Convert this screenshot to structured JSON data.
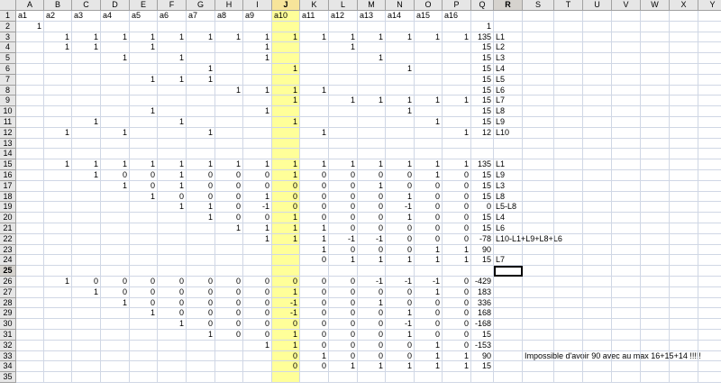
{
  "sheet": {
    "columns": [
      "A",
      "B",
      "C",
      "D",
      "E",
      "F",
      "G",
      "H",
      "I",
      "J",
      "K",
      "L",
      "M",
      "N",
      "O",
      "P",
      "Q",
      "R",
      "S",
      "T",
      "U",
      "V",
      "W",
      "X",
      "Y"
    ],
    "row_count": 35,
    "highlight_column": "J",
    "selected_column_header": "R",
    "selected_row_header": 25,
    "active_cell": "R25",
    "cells": {
      "1": {
        "A": "a1",
        "B": "a2",
        "C": "a3",
        "D": "a4",
        "E": "a5",
        "F": "a6",
        "G": "a7",
        "H": "a8",
        "I": "a9",
        "J": "a10",
        "K": "a11",
        "L": "a12",
        "M": "a13",
        "N": "a14",
        "O": "a15",
        "P": "a16"
      },
      "2": {
        "A": "1",
        "Q": "1"
      },
      "3": {
        "B": "1",
        "C": "1",
        "D": "1",
        "E": "1",
        "F": "1",
        "G": "1",
        "H": "1",
        "I": "1",
        "J": "1",
        "K": "1",
        "L": "1",
        "M": "1",
        "N": "1",
        "O": "1",
        "P": "1",
        "Q": "135",
        "R": "L1"
      },
      "4": {
        "B": "1",
        "C": "1",
        "E": "1",
        "I": "1",
        "L": "1",
        "Q": "15",
        "R": "L2"
      },
      "5": {
        "D": "1",
        "F": "1",
        "I": "1",
        "M": "1",
        "Q": "15",
        "R": "L3"
      },
      "6": {
        "G": "1",
        "J": "1",
        "N": "1",
        "Q": "15",
        "R": "L4"
      },
      "7": {
        "E": "1",
        "F": "1",
        "G": "1",
        "Q": "15",
        "R": "L5"
      },
      "8": {
        "H": "1",
        "I": "1",
        "J": "1",
        "K": "1",
        "Q": "15",
        "R": "L6"
      },
      "9": {
        "J": "1",
        "L": "1",
        "M": "1",
        "N": "1",
        "O": "1",
        "P": "1",
        "Q": "15",
        "R": "L7"
      },
      "10": {
        "E": "1",
        "I": "1",
        "N": "1",
        "Q": "15",
        "R": "L8"
      },
      "11": {
        "C": "1",
        "F": "1",
        "J": "1",
        "O": "1",
        "Q": "15",
        "R": "L9"
      },
      "12": {
        "B": "1",
        "D": "1",
        "G": "1",
        "K": "1",
        "P": "1",
        "Q": "12",
        "R": "L10"
      },
      "15": {
        "B": "1",
        "C": "1",
        "D": "1",
        "E": "1",
        "F": "1",
        "G": "1",
        "H": "1",
        "I": "1",
        "J": "1",
        "K": "1",
        "L": "1",
        "M": "1",
        "N": "1",
        "O": "1",
        "P": "1",
        "Q": "135",
        "R": "L1"
      },
      "16": {
        "C": "1",
        "D": "0",
        "E": "0",
        "F": "1",
        "G": "0",
        "H": "0",
        "I": "0",
        "J": "1",
        "K": "0",
        "L": "0",
        "M": "0",
        "N": "0",
        "O": "1",
        "P": "0",
        "Q": "15",
        "R": "L9"
      },
      "17": {
        "D": "1",
        "E": "0",
        "F": "1",
        "G": "0",
        "H": "0",
        "I": "0",
        "J": "0",
        "K": "0",
        "L": "0",
        "M": "1",
        "N": "0",
        "O": "0",
        "P": "0",
        "Q": "15",
        "R": "L3"
      },
      "18": {
        "E": "1",
        "F": "0",
        "G": "0",
        "H": "0",
        "I": "1",
        "J": "0",
        "K": "0",
        "L": "0",
        "M": "0",
        "N": "1",
        "O": "0",
        "P": "0",
        "Q": "15",
        "R": "L8"
      },
      "19": {
        "F": "1",
        "G": "1",
        "H": "0",
        "I": "-1",
        "J": "0",
        "K": "0",
        "L": "0",
        "M": "0",
        "N": "-1",
        "O": "0",
        "P": "0",
        "Q": "0",
        "R": "L5-L8"
      },
      "20": {
        "G": "1",
        "H": "0",
        "I": "0",
        "J": "1",
        "K": "0",
        "L": "0",
        "M": "0",
        "N": "1",
        "O": "0",
        "P": "0",
        "Q": "15",
        "R": "L4"
      },
      "21": {
        "H": "1",
        "I": "1",
        "J": "1",
        "K": "1",
        "L": "0",
        "M": "0",
        "N": "0",
        "O": "0",
        "P": "0",
        "Q": "15",
        "R": "L6"
      },
      "22": {
        "I": "1",
        "J": "1",
        "K": "1",
        "L": "-1",
        "M": "-1",
        "N": "0",
        "O": "0",
        "P": "0",
        "Q": "-78",
        "R": "L10-L1+L9+L8+L6"
      },
      "23": {
        "K": "1",
        "L": "0",
        "M": "0",
        "N": "0",
        "O": "1",
        "P": "1",
        "Q": "90"
      },
      "24": {
        "K": "0",
        "L": "1",
        "M": "1",
        "N": "1",
        "O": "1",
        "P": "1",
        "Q": "15",
        "R": "L7"
      },
      "26": {
        "B": "1",
        "C": "0",
        "D": "0",
        "E": "0",
        "F": "0",
        "G": "0",
        "H": "0",
        "I": "0",
        "J": "0",
        "K": "0",
        "L": "0",
        "M": "-1",
        "N": "-1",
        "O": "-1",
        "P": "0",
        "Q": "-429"
      },
      "27": {
        "C": "1",
        "D": "0",
        "E": "0",
        "F": "0",
        "G": "0",
        "H": "0",
        "I": "0",
        "J": "1",
        "K": "0",
        "L": "0",
        "M": "0",
        "N": "0",
        "O": "1",
        "P": "0",
        "Q": "183"
      },
      "28": {
        "D": "1",
        "E": "0",
        "F": "0",
        "G": "0",
        "H": "0",
        "I": "0",
        "J": "-1",
        "K": "0",
        "L": "0",
        "M": "1",
        "N": "0",
        "O": "0",
        "P": "0",
        "Q": "336"
      },
      "29": {
        "E": "1",
        "F": "0",
        "G": "0",
        "H": "0",
        "I": "0",
        "J": "-1",
        "K": "0",
        "L": "0",
        "M": "0",
        "N": "1",
        "O": "0",
        "P": "0",
        "Q": "168"
      },
      "30": {
        "F": "1",
        "G": "0",
        "H": "0",
        "I": "0",
        "J": "0",
        "K": "0",
        "L": "0",
        "M": "0",
        "N": "-1",
        "O": "0",
        "P": "0",
        "Q": "-168"
      },
      "31": {
        "G": "1",
        "H": "0",
        "I": "0",
        "J": "1",
        "K": "0",
        "L": "0",
        "M": "0",
        "N": "1",
        "O": "0",
        "P": "0",
        "Q": "15"
      },
      "32": {
        "I": "1",
        "J": "1",
        "K": "0",
        "L": "0",
        "M": "0",
        "N": "0",
        "O": "1",
        "P": "0",
        "Q": "-153"
      },
      "33": {
        "J": "0",
        "K": "1",
        "L": "0",
        "M": "0",
        "N": "0",
        "O": "1",
        "P": "1",
        "Q": "90",
        "S": "Impossible d'avoir 90 avec au max 16+15+14 !!!!!"
      },
      "34": {
        "J": "0",
        "K": "0",
        "L": "1",
        "M": "1",
        "N": "1",
        "O": "1",
        "P": "1",
        "Q": "15"
      }
    }
  }
}
